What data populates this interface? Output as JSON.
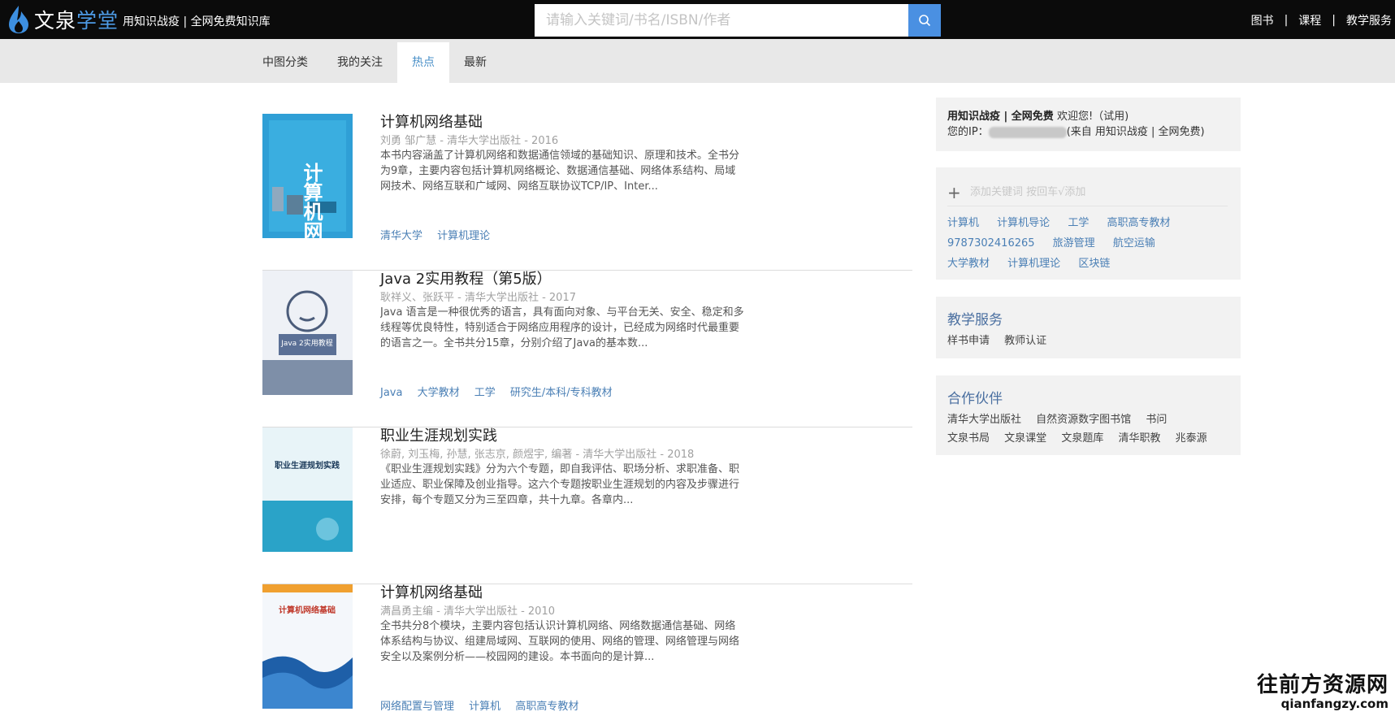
{
  "header": {
    "logo_text_1": "文泉",
    "logo_text_2": "学堂",
    "slogan": "用知识战疫 | 全网免费知识库",
    "search_placeholder": "请输入关键词/书名/ISBN/作者",
    "nav": [
      "图书",
      "课程",
      "教学服务"
    ],
    "nav_separator": "|"
  },
  "tabs": [
    {
      "label": "中图分类",
      "active": false
    },
    {
      "label": "我的关注",
      "active": false
    },
    {
      "label": "热点",
      "active": true
    },
    {
      "label": "最新",
      "active": false
    }
  ],
  "books": [
    {
      "title": "计算机网络基础",
      "meta": "刘勇 邹广慧 - 清华大学出版社 - 2016",
      "desc": "本书内容涵盖了计算机网络和数据通信领域的基础知识、原理和技术。全书分为9章，主要内容包括计算机网络概论、数据通信基础、网络体系结构、局域网技术、网络互联和广域网、网络互联协议TCP/IP、Inter...",
      "tags": [
        "清华大学",
        "计算机理论"
      ],
      "cover_text": "计算机网络基础"
    },
    {
      "title": "Java 2实用教程（第5版）",
      "meta": "耿祥义、张跃平 - 清华大学出版社 - 2017",
      "desc": "Java 语言是一种很优秀的语言，具有面向对象、与平台无关、安全、稳定和多线程等优良特性，特别适合于网络应用程序的设计，已经成为网络时代最重要的语言之一。全书共分15章，分别介绍了Java的基本数...",
      "tags": [
        "Java",
        "大学教材",
        "工学",
        "研究生/本科/专科教材"
      ],
      "cover_text": "Java 2实用教程"
    },
    {
      "title": "职业生涯规划实践",
      "meta": "徐蔚, 刘玉梅, 孙慧, 张志京, 颜煜宇, 编著 - 清华大学出版社 - 2018",
      "desc": "《职业生涯规划实践》分为六个专题，即自我评估、职场分析、求职准备、职业适应、职业保障及创业指导。这六个专题按职业生涯规划的内容及步骤进行安排，每个专题又分为三至四章，共十九章。各章内...",
      "tags": [],
      "cover_text": "职业生涯规划实践"
    },
    {
      "title": "计算机网络基础",
      "meta": "满昌勇主编 - 清华大学出版社 - 2010",
      "desc": "全书共分8个模块，主要内容包括认识计算机网络、网络数据通信基础、网络体系结构与协议、组建局域网、互联网的使用、网络的管理、网络管理与网络安全以及案例分析——校园网的建设。本书面向的是计算...",
      "tags": [
        "网络配置与管理",
        "计算机",
        "高职高专教材"
      ],
      "cover_text": "计算机网络基础"
    }
  ],
  "sidebar": {
    "welcome_bold": "用知识战疫 | 全网免费",
    "welcome_rest": " 欢迎您!（试用)",
    "ip_label": "您的IP：",
    "ip_source": "(来自 用知识战疫 | 全网免费)",
    "keyword_placeholder": "添加关键词 按回车√添加",
    "keywords": [
      [
        "计算机",
        "计算机导论",
        "工学",
        "高职高专教材"
      ],
      [
        "9787302416265",
        "旅游管理",
        "航空运输"
      ],
      [
        "大学教材",
        "计算机理论",
        "区块链"
      ]
    ],
    "teaching_title": "教学服务",
    "teaching_links": [
      "样书申请",
      "教师认证"
    ],
    "partner_title": "合作伙伴",
    "partner_links": [
      [
        "清华大学出版社",
        "自然资源数字图书馆",
        "书问"
      ],
      [
        "文泉书局",
        "文泉课堂",
        "文泉题库",
        "清华职教",
        "兆泰源"
      ]
    ]
  },
  "watermark": {
    "line1": "往前方资源网",
    "line2": "qianfangzy.com"
  },
  "colors": {
    "topbar": "#0b0b0b",
    "accent": "#4a90e2",
    "link": "#4a7fb5"
  }
}
